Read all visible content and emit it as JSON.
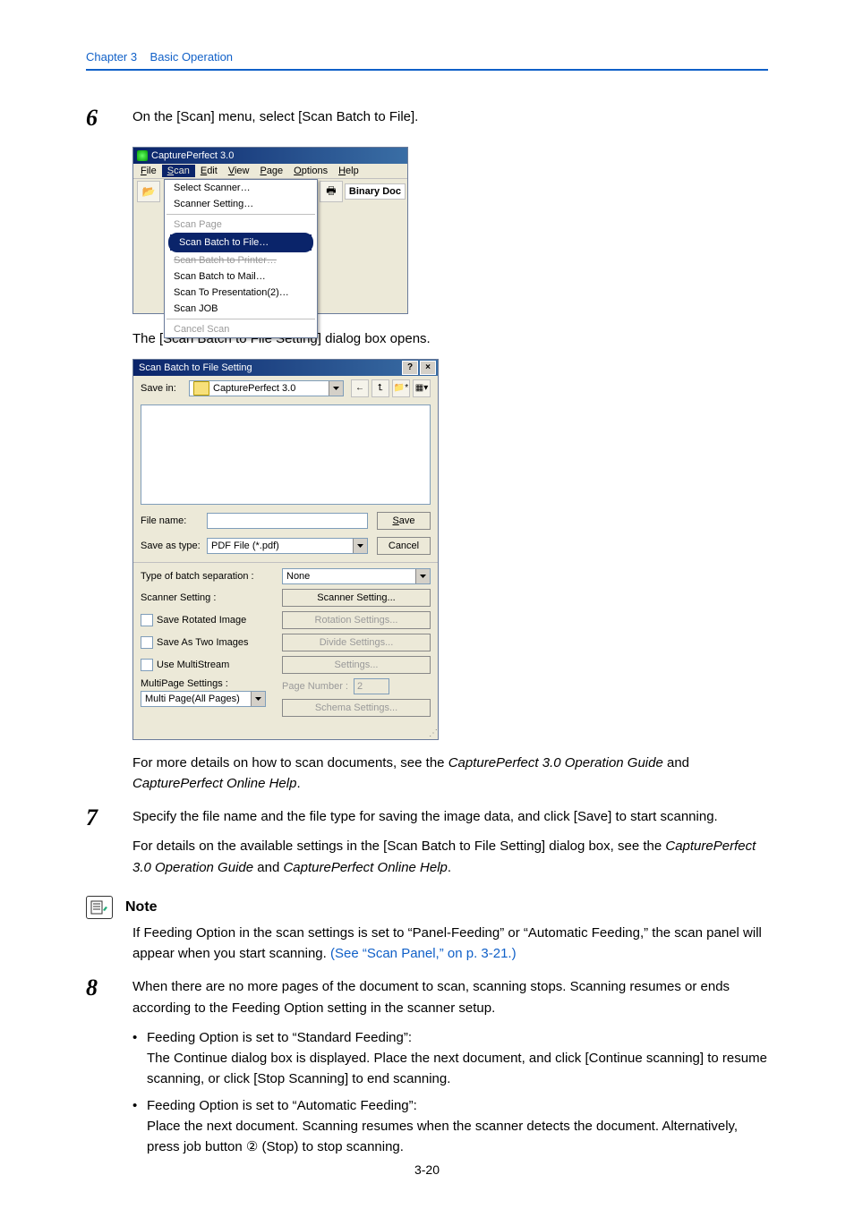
{
  "header": {
    "chapter": "Chapter 3",
    "title": "Basic Operation"
  },
  "step6": {
    "num": "6",
    "text": "On the [Scan] menu, select [Scan Batch to File].",
    "after": "The [Scan Batch to File Setting] dialog box opens.",
    "detail_prefix": "For more details on how to scan documents, see the ",
    "detail_em1": "CapturePerfect 3.0 Operation Guide",
    "detail_mid": " and ",
    "detail_em2": "CapturePerfect Online Help",
    "detail_suffix": "."
  },
  "shot1": {
    "title": "CapturePerfect 3.0",
    "menus": {
      "file": "File",
      "scan": "Scan",
      "edit": "Edit",
      "view": "View",
      "page": "Page",
      "options": "Options",
      "help": "Help"
    },
    "items": {
      "select_scanner": "Select Scanner…",
      "scanner_setting": "Scanner Setting…",
      "scan_page": "Scan Page",
      "scan_batch_file": "Scan Batch to File…",
      "scan_batch_printer": "Scan Batch to Printer…",
      "scan_batch_mail": "Scan Batch to Mail…",
      "scan_presentation": "Scan To Presentation(2)…",
      "scan_job": "Scan JOB",
      "cancel_scan": "Cancel Scan"
    },
    "binary": "Binary Doc"
  },
  "shot2": {
    "title": "Scan Batch to File Setting",
    "save_in": "Save in:",
    "folder": "CapturePerfect 3.0",
    "file_name": "File name:",
    "save_btn": "Save",
    "save_as_type": "Save as type:",
    "file_type": "PDF File (*.pdf)",
    "cancel_btn": "Cancel",
    "batch_sep_lbl": "Type of batch separation :",
    "batch_sep_val": "None",
    "scanner_setting_lbl": "Scanner Setting :",
    "scanner_setting_btn": "Scanner Setting...",
    "save_rotated": "Save Rotated Image",
    "rotation_btn": "Rotation Settings...",
    "save_two": "Save As Two Images",
    "divide_btn": "Divide Settings...",
    "use_multi": "Use MultiStream",
    "settings_btn": "Settings...",
    "multipage_lbl": "MultiPage Settings :",
    "multipage_val": "Multi Page(All Pages)",
    "page_number_lbl": "Page Number :",
    "page_number_val": "2",
    "schema_btn": "Schema Settings..."
  },
  "step7": {
    "num": "7",
    "line1": "Specify the file name and the file type for saving the image data, and click [Save] to start scanning.",
    "line2_pre": "For details on the available settings in the [Scan Batch to File Setting] dialog box, see the ",
    "line2_em1": "CapturePerfect 3.0 Operation Guide",
    "line2_mid": " and ",
    "line2_em2": "CapturePerfect Online Help",
    "line2_suf": "."
  },
  "note": {
    "label": "Note",
    "text": "If Feeding Option in the scan settings is set to “Panel-Feeding” or “Automatic Feeding,” the scan panel will appear when you start scanning. ",
    "link": "(See “Scan Panel,” on p. 3-21.)"
  },
  "step8": {
    "num": "8",
    "intro": "When there are no more pages of the document to scan, scanning stops. Scanning resumes or ends according to the Feeding Option setting in the scanner setup.",
    "b1_head": "Feeding Option is set to “Standard Feeding”:",
    "b1_body": "The Continue dialog box is displayed. Place the next document, and click [Continue scanning] to resume scanning, or click [Stop Scanning] to end scanning.",
    "b2_head": "Feeding Option is set to “Automatic Feeding”:",
    "b2_body": "Place the next document. Scanning resumes when the scanner detects the document. Alternatively, press job button ② (Stop) to stop scanning."
  },
  "pageno": "3-20"
}
